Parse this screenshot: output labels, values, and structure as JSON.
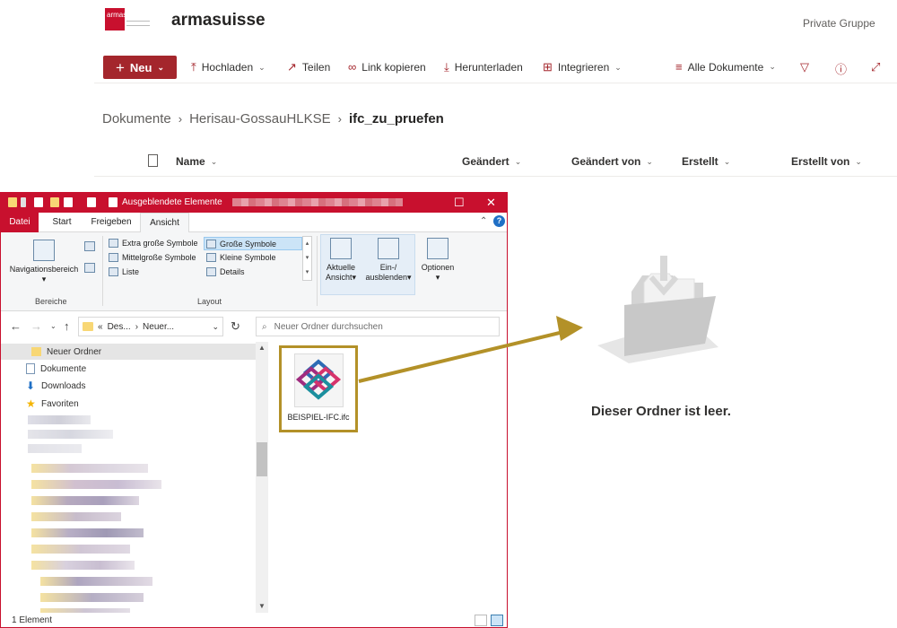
{
  "sharepoint": {
    "logo_text": "armasuisse",
    "site_title": "armasuisse",
    "group_type": "Private Gruppe",
    "commands": {
      "new_label": "Neu",
      "upload_label": "Hochladen",
      "share_label": "Teilen",
      "copy_link_label": "Link kopieren",
      "download_label": "Herunterladen",
      "integrate_label": "Integrieren",
      "view_label": "Alle Dokumente"
    },
    "breadcrumb": [
      "Dokumente",
      "Herisau-GossauHLKSE",
      "ifc_zu_pruefen"
    ],
    "columns": {
      "name": "Name",
      "modified": "Geändert",
      "modified_by": "Geändert von",
      "created": "Erstellt",
      "created_by": "Erstellt von"
    },
    "empty_message": "Dieser Ordner ist leer."
  },
  "explorer": {
    "title_checkbox_label": "Ausgeblendete Elemente",
    "tabs": [
      "Datei",
      "Start",
      "Freigeben",
      "Ansicht"
    ],
    "ribbon": {
      "nav_pane_label": "Navigationsbereich",
      "group_panes": "Bereiche",
      "layout_options": [
        "Extra große Symbole",
        "Große Symbole",
        "Mittelgroße Symbole",
        "Kleine Symbole",
        "Liste",
        "Details"
      ],
      "selected_layout": "Große Symbole",
      "group_layout": "Layout",
      "current_view_line1": "Aktuelle",
      "current_view_line2": "Ansicht",
      "show_hide_line1": "Ein-/",
      "show_hide_line2": "ausblenden",
      "options_label": "Optionen"
    },
    "address": {
      "prefix": "«",
      "part1": "Des...",
      "part2": "Neuer..."
    },
    "search_placeholder": "Neuer Ordner durchsuchen",
    "nav_items": [
      {
        "label": "Neuer Ordner",
        "icon": "folder-icon",
        "selected": true
      },
      {
        "label": "Dokumente",
        "icon": "document-icon",
        "selected": false
      },
      {
        "label": "Downloads",
        "icon": "download-icon",
        "selected": false
      },
      {
        "label": "Favoriten",
        "icon": "star-icon",
        "selected": false
      }
    ],
    "file": {
      "name": "BEISPIEL-IFC.ifc",
      "icon": "ifc-file-icon"
    },
    "status": "1 Element"
  },
  "colors": {
    "brand_red": "#c8102e",
    "sp_accent": "#a4262c",
    "arrow_gold": "#b39128"
  }
}
